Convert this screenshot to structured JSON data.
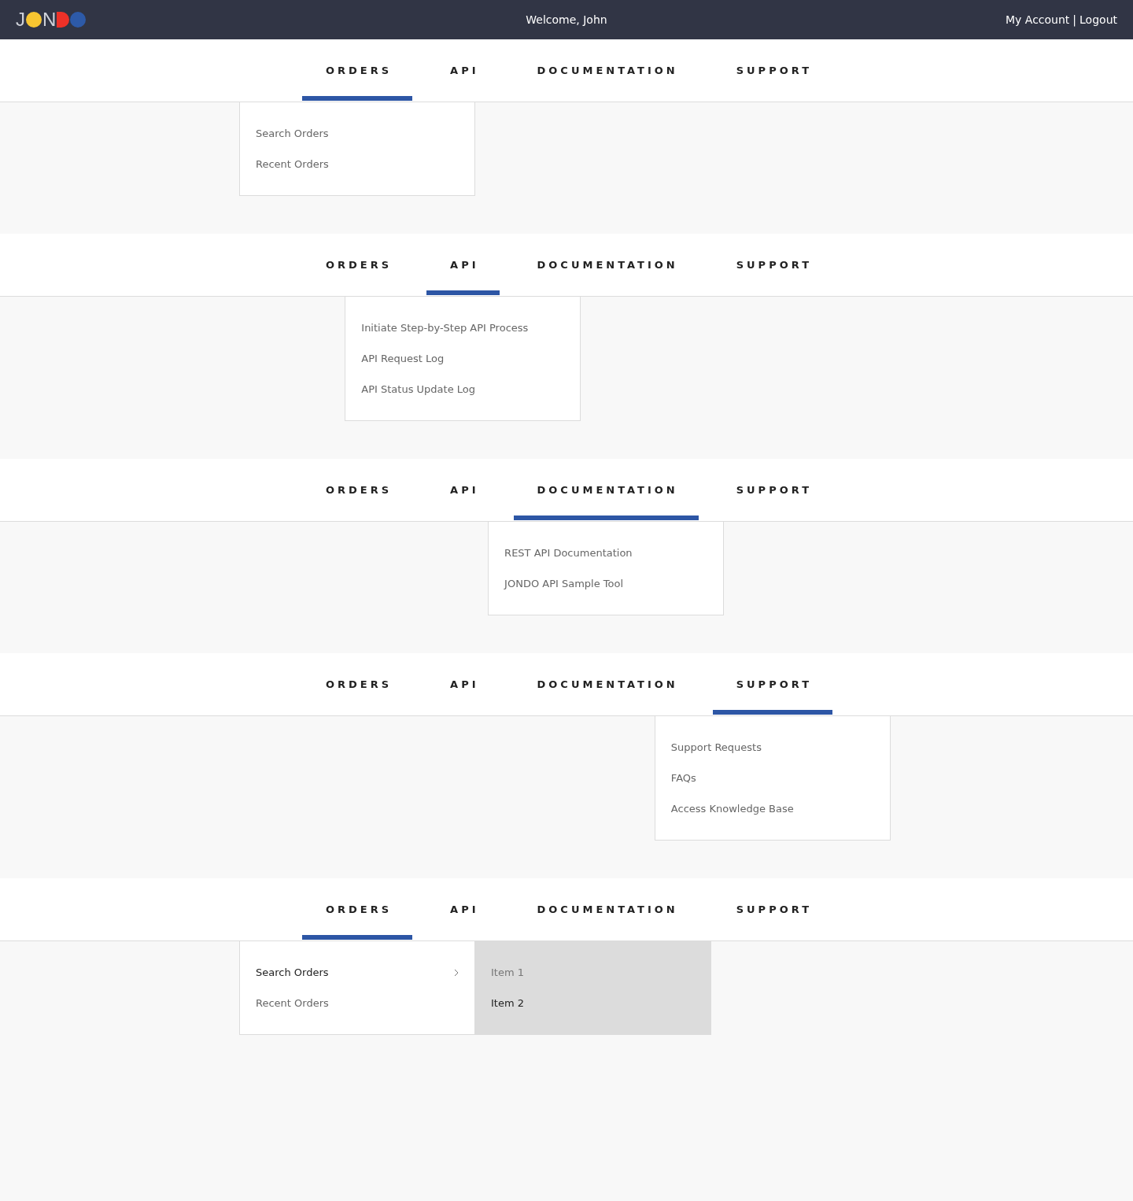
{
  "header": {
    "logo": [
      {
        "kind": "letter",
        "char": "J"
      },
      {
        "kind": "dot",
        "color": "#f7c531"
      },
      {
        "kind": "letter",
        "char": "N"
      },
      {
        "kind": "half",
        "color": "#ee3128"
      },
      {
        "kind": "dot",
        "color": "#2d5aa8"
      }
    ],
    "welcome": "Welcome, John",
    "links": [
      "My Account",
      "Logout"
    ],
    "separator": "|"
  },
  "sections": [
    {
      "tabs": [
        {
          "label": "ORDERS",
          "selected": true
        },
        {
          "label": "API",
          "selected": false
        },
        {
          "label": "DOCUMENTATION",
          "selected": false
        },
        {
          "label": "SUPPORT",
          "selected": false
        }
      ],
      "menu": {
        "items": [
          {
            "label": "Search Orders"
          },
          {
            "label": "Recent Orders"
          }
        ]
      }
    },
    {
      "tabs": [
        {
          "label": "ORDERS",
          "selected": false
        },
        {
          "label": "API",
          "selected": true
        },
        {
          "label": "DOCUMENTATION",
          "selected": false
        },
        {
          "label": "SUPPORT",
          "selected": false
        }
      ],
      "menu": {
        "items": [
          {
            "label": "Initiate Step-by-Step API Process"
          },
          {
            "label": "API Request Log"
          },
          {
            "label": "API Status Update Log"
          }
        ]
      }
    },
    {
      "tabs": [
        {
          "label": "ORDERS",
          "selected": false
        },
        {
          "label": "API",
          "selected": false
        },
        {
          "label": "DOCUMENTATION",
          "selected": true
        },
        {
          "label": "SUPPORT",
          "selected": false
        }
      ],
      "menu": {
        "items": [
          {
            "label": "REST API Documentation"
          },
          {
            "label": "JONDO API Sample Tool"
          }
        ]
      }
    },
    {
      "tabs": [
        {
          "label": "ORDERS",
          "selected": false
        },
        {
          "label": "API",
          "selected": false
        },
        {
          "label": "DOCUMENTATION",
          "selected": false
        },
        {
          "label": "SUPPORT",
          "selected": true
        }
      ],
      "menu": {
        "items": [
          {
            "label": "Support Requests"
          },
          {
            "label": "FAQs"
          },
          {
            "label": "Access Knowledge Base"
          }
        ]
      }
    },
    {
      "tabs": [
        {
          "label": "ORDERS",
          "selected": true
        },
        {
          "label": "API",
          "selected": false
        },
        {
          "label": "DOCUMENTATION",
          "selected": false
        },
        {
          "label": "SUPPORT",
          "selected": false
        }
      ],
      "menu": {
        "items": [
          {
            "label": "Search Orders",
            "expanded": true
          },
          {
            "label": "Recent Orders",
            "expanded": false
          }
        ],
        "submenu": {
          "items": [
            {
              "label": "Item 1",
              "selected": false
            },
            {
              "label": "Item 2",
              "selected": true
            }
          ]
        }
      }
    }
  ]
}
